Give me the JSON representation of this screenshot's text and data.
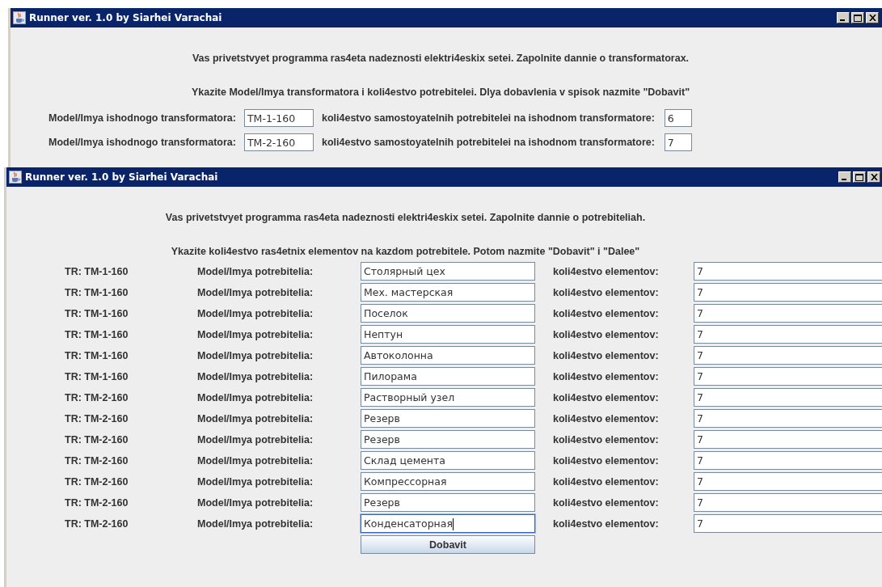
{
  "windows": [
    {
      "title": "Runner ver. 1.0 by Siarhei Varachai",
      "intro": "Vas privetstvyet programma ras4eta nadeznosti elektri4eskix setei. Zapolnite dannie o transformatorax.",
      "instruction": "Ykazite Model/Imya transformatora i koli4estvo potrebitelei. Dlya dobavlenia v spisok nazmite \"Dobavit\"",
      "rows": [
        {
          "model_label": "Model/Imya ishodnogo transformatora:",
          "model": "TM-1-160",
          "count_label": "koli4estvo samostoyatelnih potrebitelei na ishodnom transformatore:",
          "count": "6"
        },
        {
          "model_label": "Model/Imya ishodnogo transformatora:",
          "model": "TM-2-160",
          "count_label": "koli4estvo samostoyatelnih potrebitelei na ishodnom transformatore:",
          "count": "7"
        }
      ]
    },
    {
      "title": "Runner ver. 1.0 by Siarhei Varachai",
      "intro": "Vas privetstvyet programma ras4eta nadeznosti elektri4eskix setei. Zapolnite dannie o potrebiteliah.",
      "instruction": "Ykazite koli4estvo ras4etnix elementov na kazdom potrebitele. Potom nazmite \"Dobavit\" i \"Dalee\"",
      "consumers": [
        {
          "tr": "TR: TM-1-160",
          "name_label": "Model/Imya potrebitelia:",
          "name": "Столярный цех",
          "count_label": "koli4estvo elementov:",
          "count": "7",
          "focused": false
        },
        {
          "tr": "TR: TM-1-160",
          "name_label": "Model/Imya potrebitelia:",
          "name": "Мех. мастерская",
          "count_label": "koli4estvo elementov:",
          "count": "7",
          "focused": false
        },
        {
          "tr": "TR: TM-1-160",
          "name_label": "Model/Imya potrebitelia:",
          "name": "Поселок",
          "count_label": "koli4estvo elementov:",
          "count": "7",
          "focused": false
        },
        {
          "tr": "TR: TM-1-160",
          "name_label": "Model/Imya potrebitelia:",
          "name": "Нептун",
          "count_label": "koli4estvo elementov:",
          "count": "7",
          "focused": false
        },
        {
          "tr": "TR: TM-1-160",
          "name_label": "Model/Imya potrebitelia:",
          "name": "Автоколонна",
          "count_label": "koli4estvo elementov:",
          "count": "7",
          "focused": false
        },
        {
          "tr": "TR: TM-1-160",
          "name_label": "Model/Imya potrebitelia:",
          "name": "Пилорама",
          "count_label": "koli4estvo elementov:",
          "count": "7",
          "focused": false
        },
        {
          "tr": "TR: TM-2-160",
          "name_label": "Model/Imya potrebitelia:",
          "name": "Растворный узел",
          "count_label": "koli4estvo elementov:",
          "count": "7",
          "focused": false
        },
        {
          "tr": "TR: TM-2-160",
          "name_label": "Model/Imya potrebitelia:",
          "name": "Резерв",
          "count_label": "koli4estvo elementov:",
          "count": "7",
          "focused": false
        },
        {
          "tr": "TR: TM-2-160",
          "name_label": "Model/Imya potrebitelia:",
          "name": "Резерв",
          "count_label": "koli4estvo elementov:",
          "count": "7",
          "focused": false
        },
        {
          "tr": "TR: TM-2-160",
          "name_label": "Model/Imya potrebitelia:",
          "name": "Склад цемента",
          "count_label": "koli4estvo elementov:",
          "count": "7",
          "focused": false
        },
        {
          "tr": "TR: TM-2-160",
          "name_label": "Model/Imya potrebitelia:",
          "name": "Компрессорная",
          "count_label": "koli4estvo elementov:",
          "count": "7",
          "focused": false
        },
        {
          "tr": "TR: TM-2-160",
          "name_label": "Model/Imya potrebitelia:",
          "name": "Резерв",
          "count_label": "koli4estvo elementov:",
          "count": "7",
          "focused": false
        },
        {
          "tr": "TR: TM-2-160",
          "name_label": "Model/Imya potrebitelia:",
          "name": "Конденсаторная",
          "count_label": "koli4estvo elementov:",
          "count": "7",
          "focused": true
        }
      ],
      "button": "Dobavit"
    }
  ]
}
